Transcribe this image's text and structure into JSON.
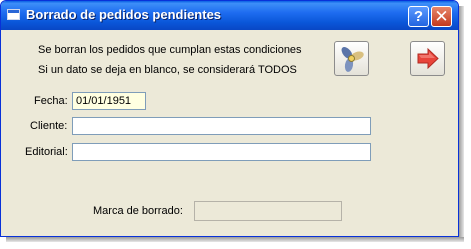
{
  "window": {
    "title": "Borrado de pedidos pendientes"
  },
  "titlebar": {
    "help_label": "?",
    "close_label": "✕"
  },
  "info": {
    "line1": "Se borran los pedidos que cumplan estas condiciones",
    "line2": "Si un dato se deja en blanco, se considerará TODOS"
  },
  "toolbar": {
    "execute_icon": "propeller-icon",
    "exit_icon": "exit-arrow-icon"
  },
  "form": {
    "fecha_label": "Fecha:",
    "fecha_value": "01/01/1951",
    "cliente_label": "Cliente:",
    "cliente_value": "",
    "editorial_label": "Editorial:",
    "editorial_value": "",
    "marca_label": "Marca de borrado:",
    "marca_value": ""
  },
  "colors": {
    "titlebar": "#0a56d8",
    "window_bg": "#ece9d8",
    "date_field_bg": "#ffffe1",
    "exit_arrow": "#e8443a"
  }
}
